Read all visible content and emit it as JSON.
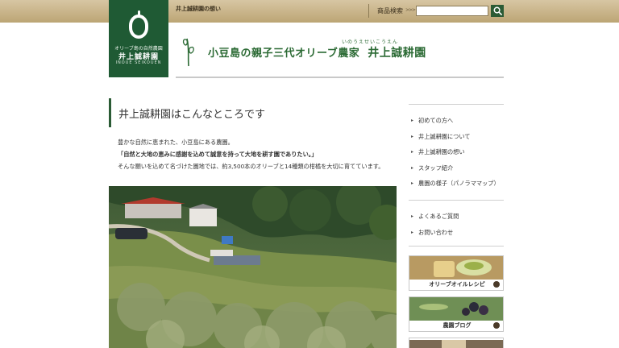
{
  "topbar": {
    "tagline": "井上誠耕園の想い",
    "search_label": "商品検索",
    "search_arrows": ">>>",
    "search_placeholder": "",
    "search_icon": "search-icon"
  },
  "logo": {
    "line1": "オリーブ島の自然農園",
    "line2": "井上誠耕園",
    "line3": "INOUE SEIKOUEN"
  },
  "header": {
    "title": "小豆島の親子三代オリーブ農家",
    "farm_name": "井上誠耕園",
    "ruby": "いのうえせいこうえん"
  },
  "main": {
    "title": "井上誠耕園はこんなところです",
    "intro_line1": "豊かな自然に恵まれた、小豆島にある農園。",
    "intro_line2": "「自然と大地の恵みに感謝を込めて誠意を持って大地を耕す園でありたい。」",
    "intro_line3": "そんな願いを込めて名づけた園地では、約3,500本のオリーブと14種類の柑橘を大切に育てています。"
  },
  "sidebar": {
    "group1": [
      "初めての方へ",
      "井上誠耕園について",
      "井上誠耕園の想い",
      "スタッフ紹介",
      "農園の様子（パノラママップ）"
    ],
    "group2": [
      "よくあるご質問",
      "お問い合わせ"
    ]
  },
  "banners": [
    {
      "label": "オリーブオイルレシピ"
    },
    {
      "label": "農園ブログ"
    }
  ],
  "colors": {
    "brand_green": "#1f5a34",
    "accent_green": "#2b6a34",
    "topbar_tan": "#c7b287"
  }
}
